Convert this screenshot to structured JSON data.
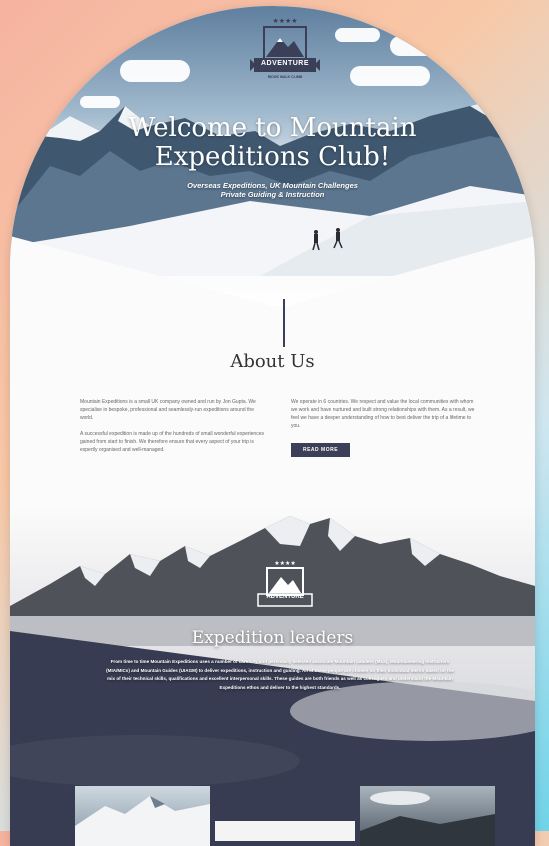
{
  "hero": {
    "title_line1": "Welcome to Mountain",
    "title_line2": "Expeditions Club!",
    "subtitle_line1": "Overseas Expeditions, UK Mountain Challenges",
    "subtitle_line2": "Private Guiding & Instruction"
  },
  "logo": {
    "text": "ADVENTURE",
    "tagline": "RIDGE WALK CLIMB",
    "icon": "mountain-logo-icon"
  },
  "about": {
    "title": "About Us",
    "col1_p1": "Mountain Expeditions is a small UK company owned and run by Jon Gupta. We specialise in bespoke, professional and seamlessly-run expeditions around the world.",
    "col1_p2": "A successful expedition is made up of the hundreds of small wonderful experiences gained from start to finish. We therefore ensure that every aspect of your trip is expertly organised and well-managed.",
    "col2_p1": "We operate in 6 countries. We respect and value the local communities with whom we work and have nurtured and built strong relationships with them. As a result, we feel we have a deeper understanding of how to best deliver the trip of a lifetime to you.",
    "button": "READ MORE"
  },
  "expedition": {
    "title": "Expedition leaders",
    "text": "From time to time Mountain Expeditions uses a number of carefully and personally selected associate Mountain Leaders (MLs), Mountaineering Instructors (MIA/MICs) and Mountain Guides (UIAGM) to deliver expeditions, instruction and guiding. All of these people are chosen on their individual merits based on the mix of their technical skills, qualifications and excellent interpersonal skills. These guides are both friends as well as colleagues and understand the Mountain Expeditions ethos and deliver to the highest standards."
  },
  "colors": {
    "accent": "#3b3f57",
    "background_left": "#f6b3a0",
    "background_right": "#6fd3e8"
  }
}
